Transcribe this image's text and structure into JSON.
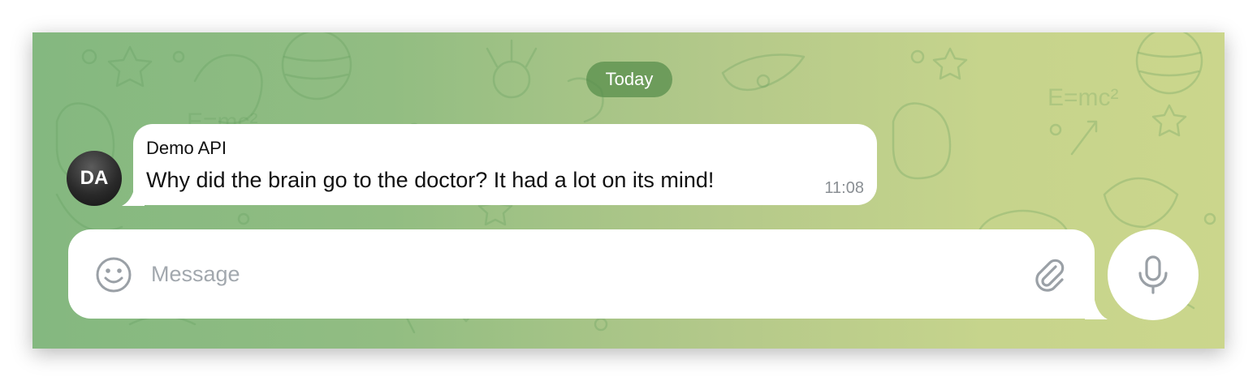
{
  "chat": {
    "date_label": "Today",
    "messages": [
      {
        "sender": "Demo API",
        "avatar_initials": "DA",
        "text": "Why did the brain go to the doctor? It had a lot on its mind!",
        "time": "11:08"
      }
    ]
  },
  "composer": {
    "placeholder": "Message",
    "value": "",
    "emoji_icon": "smiley-icon",
    "attach_icon": "paperclip-icon",
    "send_icon": "microphone-icon"
  },
  "colors": {
    "background_left": "#84b880",
    "background_right": "#cbd68c",
    "date_pill": "#548c4a",
    "bubble": "#ffffff",
    "icon_gray": "#9aa0a6"
  }
}
